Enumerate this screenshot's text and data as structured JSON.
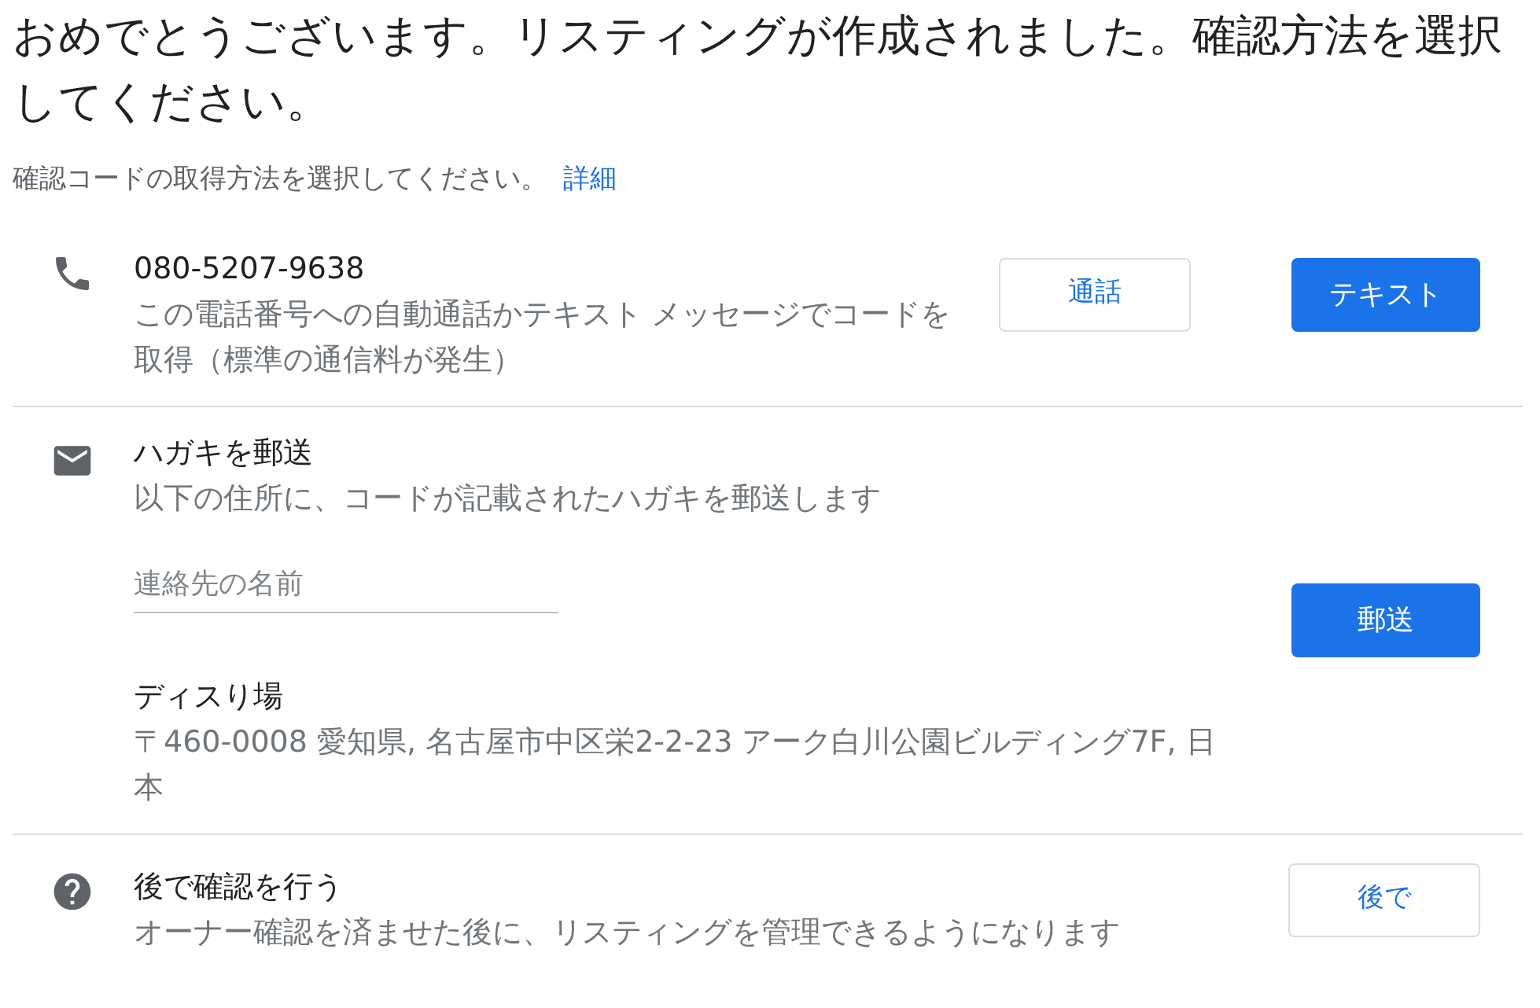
{
  "title": "おめでとうございます。リスティングが作成されました。確認方法を選択してください。",
  "subtitle": {
    "text": "確認コードの取得方法を選択してください。",
    "link": "詳細"
  },
  "options": [
    {
      "kind": "phone",
      "title": "080-5207-9638",
      "description": "この電話番号への自動通話かテキスト メッセージでコードを取得（標準の通信料が発生）",
      "buttons": [
        {
          "label": "通話",
          "primary": false
        },
        {
          "label": "テキスト",
          "primary": true
        }
      ]
    },
    {
      "kind": "mail",
      "title": "ハガキを郵送",
      "description": "以下の住所に、コードが記載されたハガキを郵送します",
      "name_field": {
        "placeholder": "連絡先の名前"
      },
      "recipient": "ディスり場",
      "address": "〒460-0008 愛知県, 名古屋市中区栄2-2-23 アーク白川公園ビルディング7F, 日本",
      "buttons": [
        {
          "label": "郵送",
          "primary": true
        }
      ]
    },
    {
      "kind": "later",
      "title": "後で確認を行う",
      "description": "オーナー確認を済ませた後に、リスティングを管理できるようになります",
      "buttons": [
        {
          "label": "後で",
          "primary": false
        }
      ]
    }
  ]
}
